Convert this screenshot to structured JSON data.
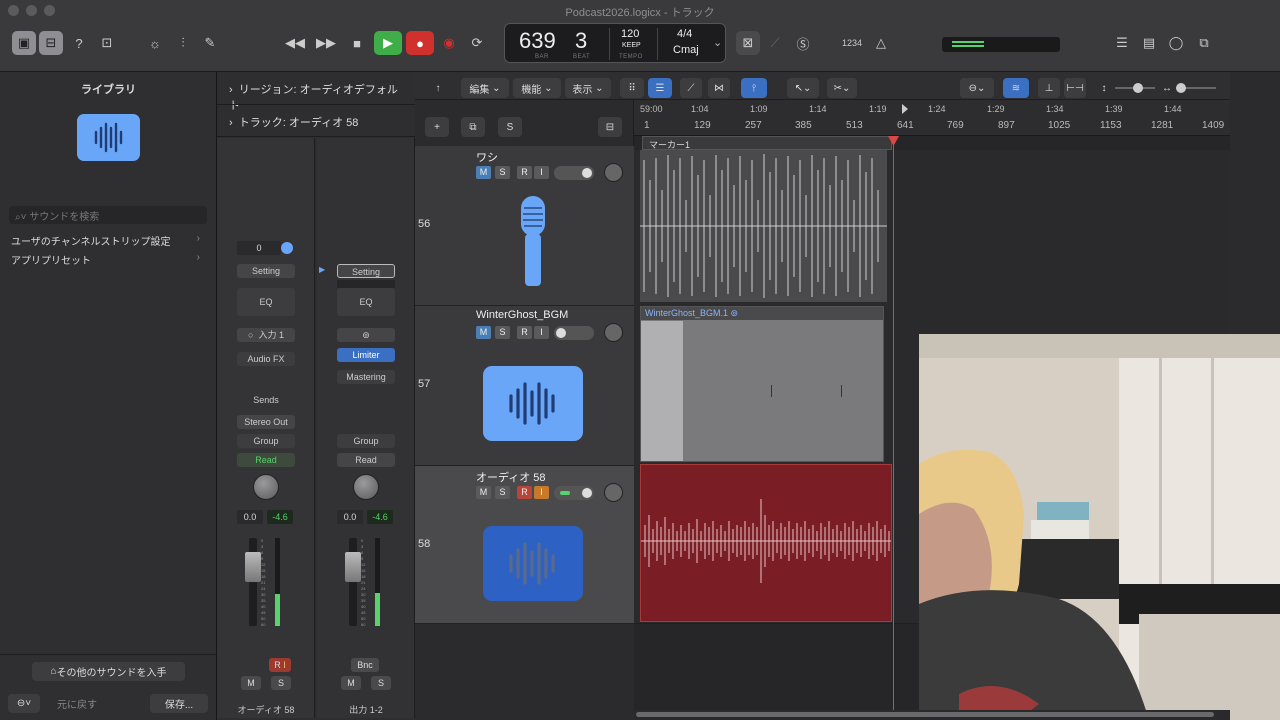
{
  "window": {
    "title": "Podcast2026.logicx - トラック"
  },
  "lcd": {
    "bar": "639",
    "beat": "3",
    "bar_label": "BAR",
    "beat_label": "BEAT",
    "tempo": "120",
    "tempo_mode": "KEEP",
    "tempo_label": "TEMPO",
    "time_sig": "4/4",
    "key": "Cmaj"
  },
  "toolbar": {
    "count_in": "1234"
  },
  "library": {
    "title": "ライブラリ",
    "search_placeholder": "サウンドを検索",
    "items": [
      {
        "label": "ユーザのチャンネルストリップ設定"
      },
      {
        "label": "アプリプリセット"
      }
    ],
    "get_more": "その他のサウンドを入手",
    "revert": "元に戻す",
    "save": "保存..."
  },
  "inspector": {
    "region_row": "リージョン: オーディオデフォルト",
    "track_row": "トラック: オーディオ 58",
    "strip1": {
      "gain": "0",
      "setting": "Setting",
      "eq": "EQ",
      "input": "入力 1",
      "audio_fx": "Audio FX",
      "sends": "Sends",
      "output": "Stereo Out",
      "group": "Group",
      "automation": "Read",
      "vol": "0.0",
      "peak": "-4.6",
      "r": "R",
      "i": "I",
      "m": "M",
      "s": "S",
      "name": "オーディオ 58"
    },
    "strip2": {
      "setting": "Setting",
      "eq": "EQ",
      "limiter": "Limiter",
      "mastering": "Mastering",
      "group": "Group",
      "automation": "Read",
      "vol": "0.0",
      "peak": "-4.6",
      "bnc": "Bnc",
      "m": "M",
      "s": "S",
      "name": "出力 1-2"
    },
    "fader_scale": [
      "0",
      "3",
      "6",
      "9",
      "12",
      "15",
      "18",
      "21",
      "24",
      "30",
      "35",
      "40",
      "45",
      "50",
      "60"
    ]
  },
  "tracks_toolbar": {
    "edit": "編集",
    "function": "機能",
    "view": "表示"
  },
  "tracks": [
    {
      "num": "56",
      "name": "ワシ",
      "m": "M",
      "s": "S",
      "r": "R",
      "i": "I"
    },
    {
      "num": "57",
      "name": "WinterGhost_BGM",
      "m": "M",
      "s": "S",
      "r": "R",
      "i": "I"
    },
    {
      "num": "58",
      "name": "オーディオ 58",
      "m": "M",
      "s": "S",
      "r": "R",
      "i": "I"
    }
  ],
  "ruler": {
    "times": [
      "59:00",
      "1:04",
      "1:09",
      "1:14",
      "1:19",
      "1:24",
      "1:29",
      "1:34",
      "1:39",
      "1:44"
    ],
    "bars": [
      "1",
      "129",
      "257",
      "385",
      "513",
      "641",
      "769",
      "897",
      "1025",
      "1153",
      "1281",
      "1409"
    ],
    "marker": "マーカー1"
  },
  "regions": {
    "bgm": "WinterGhost_BGM.1"
  },
  "colors": {
    "accent": "#4a90e2",
    "record": "#d0312d",
    "play": "#3fae48",
    "audio_region": "#7a1d24",
    "meter": "#58d26a"
  }
}
